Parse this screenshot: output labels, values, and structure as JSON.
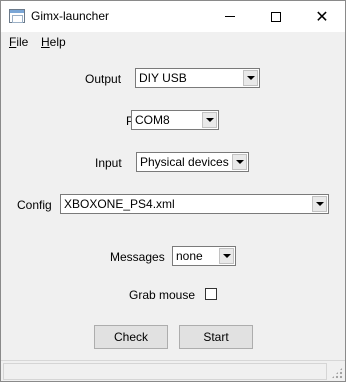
{
  "window": {
    "title": "Gimx-launcher",
    "minimize_icon": "minimize-icon",
    "maximize_icon": "maximize-icon",
    "close_icon": "close-icon"
  },
  "menu": {
    "file_mnemonic": "F",
    "file_rest": "ile",
    "help_mnemonic": "H",
    "help_rest": "elp"
  },
  "form": {
    "output_label": "Output",
    "output_value": "DIY USB",
    "port_label": "Port",
    "port_value": "COM8",
    "input_label": "Input",
    "input_value": "Physical devices",
    "config_label": "Config",
    "config_value": "XBOXONE_PS4.xml",
    "messages_label": "Messages",
    "messages_value": "none",
    "grab_mouse_label": "Grab mouse",
    "grab_mouse_checked": false
  },
  "buttons": {
    "check_label": "Check",
    "start_label": "Start"
  },
  "status": {
    "text": ""
  },
  "colors": {
    "window_bg": "#f0f0f0",
    "titlebar_bg": "#ffffff",
    "button_bg": "#e1e1e1"
  }
}
